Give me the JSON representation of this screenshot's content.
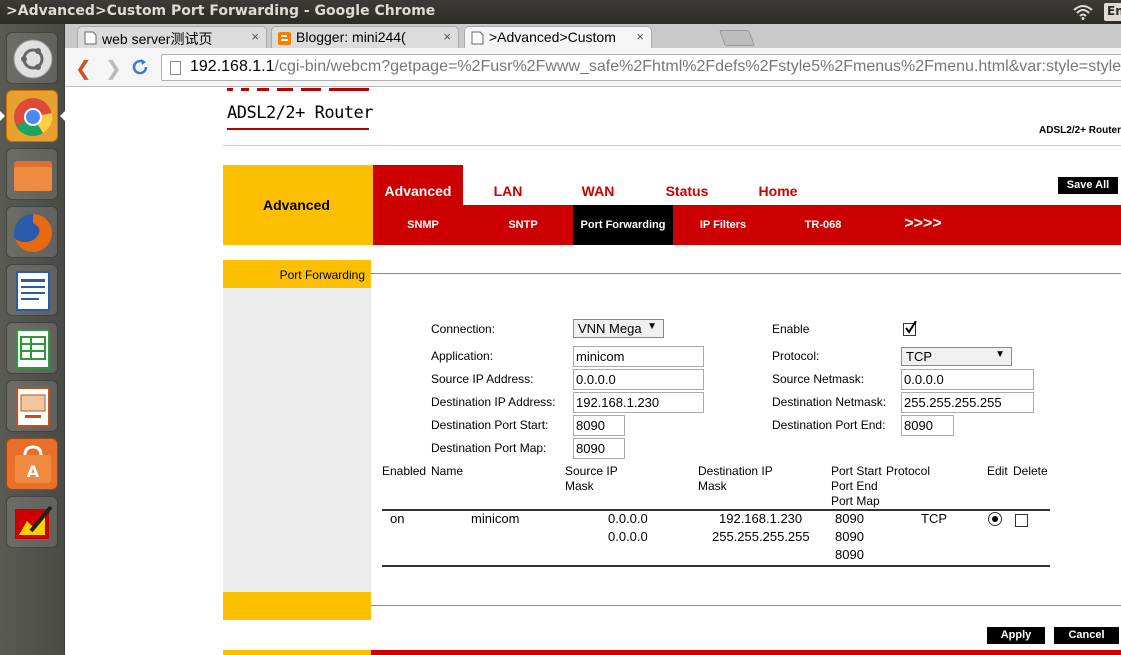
{
  "topbar": {
    "window_title": ">Advanced>Custom Port Forwarding - Google Chrome",
    "keyboard_indicator": "En"
  },
  "launcher": {
    "items": [
      "ubuntu-dash",
      "chrome",
      "files",
      "firefox",
      "libreoffice-writer",
      "libreoffice-calc",
      "libreoffice-impress",
      "software-center",
      "paint-app"
    ]
  },
  "browser": {
    "tabs": [
      {
        "label": "web server测试页",
        "close": "×"
      },
      {
        "label": "Blogger: mini244(",
        "close": "×"
      },
      {
        "label": ">Advanced>Custom",
        "close": "×"
      }
    ],
    "url_host": "192.168.1.1",
    "url_path": "/cgi-bin/webcm?getpage=%2Fusr%2Fwww_safe%2Fhtml%2Fdefs%2Fstyle5%2Fmenus%2Fmenu.html&var:style=style"
  },
  "router": {
    "logo": "ADSL2/2+ Router",
    "model": "ADSL2/2+ Router",
    "section_title": "Advanced",
    "main_tabs": [
      "Advanced",
      "LAN",
      "WAN",
      "Status",
      "Home"
    ],
    "save_all": "Save All",
    "sub_tabs": [
      "SNMP",
      "SNTP",
      "Port Forwarding",
      "IP Filters",
      "TR-068",
      ">>>>"
    ],
    "page_title": "Port Forwarding",
    "form": {
      "connection_label": "Connection:",
      "connection_value": "VNN Mega",
      "enable_label": "Enable",
      "enable_checked": true,
      "application_label": "Application:",
      "application_value": "minicom",
      "protocol_label": "Protocol:",
      "protocol_value": "TCP",
      "src_ip_label": "Source IP Address:",
      "src_ip_value": "0.0.0.0",
      "src_mask_label": "Source Netmask:",
      "src_mask_value": "0.0.0.0",
      "dst_ip_label": "Destination IP Address:",
      "dst_ip_value": "192.168.1.230",
      "dst_mask_label": "Destination Netmask:",
      "dst_mask_value": "255.255.255.255",
      "port_start_label": "Destination Port Start:",
      "port_start_value": "8090",
      "port_end_label": "Destination Port End:",
      "port_end_value": "8090",
      "port_map_label": "Destination Port Map:",
      "port_map_value": "8090"
    },
    "table": {
      "headers": {
        "enabled": "Enabled",
        "name": "Name",
        "src_1": "Source IP",
        "src_2": "Mask",
        "dst_1": "Destination IP",
        "dst_2": "Mask",
        "port_1": "Port Start",
        "port_2": "Port End",
        "port_3": "Port Map",
        "protocol": "Protocol",
        "edit": "Edit",
        "delete": "Delete"
      },
      "rows": [
        {
          "enabled": "on",
          "name": "minicom",
          "src_ip": "0.0.0.0",
          "src_mask": "0.0.0.0",
          "dst_ip": "192.168.1.230",
          "dst_mask": "255.255.255.255",
          "port_start": "8090",
          "port_end": "8090",
          "port_map": "8090",
          "protocol": "TCP",
          "edit_selected": true,
          "delete_checked": false
        }
      ]
    },
    "apply": "Apply",
    "cancel": "Cancel"
  }
}
